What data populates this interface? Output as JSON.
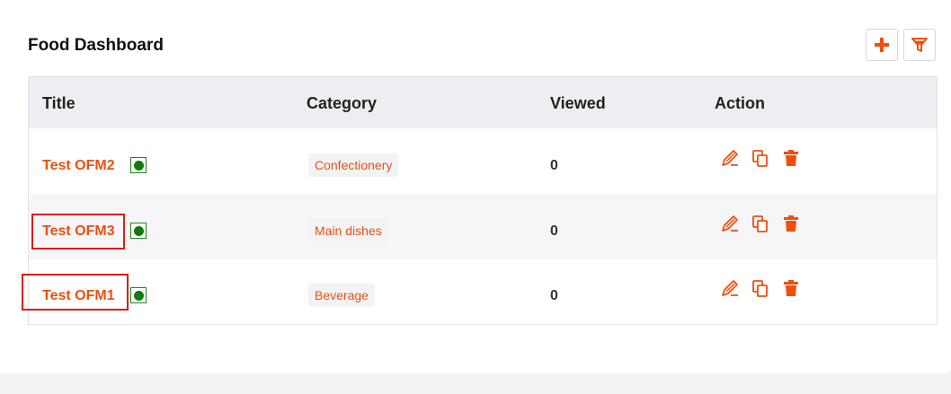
{
  "header": {
    "title": "Food Dashboard",
    "add_icon": "plus-icon",
    "filter_icon": "filter-icon"
  },
  "table": {
    "columns": [
      "Title",
      "Category",
      "Viewed",
      "Action"
    ],
    "rows": [
      {
        "title": "Test OFM2",
        "status": "active",
        "category": "Confectionery",
        "viewed": "0"
      },
      {
        "title": "Test OFM3",
        "status": "active",
        "category": "Main dishes",
        "viewed": "0"
      },
      {
        "title": "Test OFM1",
        "status": "active",
        "category": "Beverage",
        "viewed": "0"
      }
    ],
    "action_icons": [
      "edit-icon",
      "duplicate-icon",
      "delete-icon"
    ]
  },
  "colors": {
    "accent": "#f04e0f",
    "status_green": "#137a13",
    "highlight_red": "#e01818",
    "header_bg": "#eeeef2"
  }
}
